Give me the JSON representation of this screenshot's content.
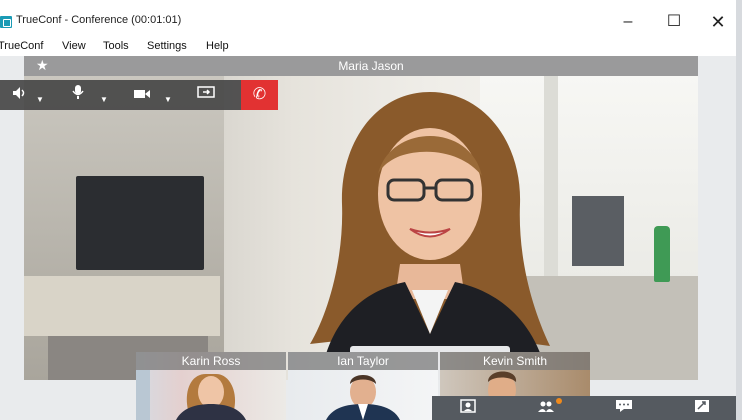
{
  "window": {
    "title": "TrueConf - Conference (00:01:01)",
    "min_label": "–",
    "max_label": "☐",
    "close_label": "✕"
  },
  "menu": [
    "TrueConf",
    "View",
    "Tools",
    "Settings",
    "Help"
  ],
  "conference": {
    "main_speaker": "Maria Jason",
    "star_glyph": "★",
    "hangup_glyph": "✆"
  },
  "participants": [
    {
      "name": "Karin Ross"
    },
    {
      "name": "Ian Taylor"
    },
    {
      "name": "Kevin Smith"
    }
  ],
  "toolbar": {
    "speaker_icon": "speaker-icon",
    "mic_icon": "microphone-icon",
    "camera_icon": "camera-icon",
    "share_icon": "screen-share-icon",
    "hangup_icon": "hangup-icon"
  },
  "bottom_toolbar": {
    "icons": [
      "participant-icon",
      "group-icon",
      "chat-icon",
      "fullscreen-icon"
    ]
  },
  "colors": {
    "hangup_bg": "#e23232",
    "brand": "#1a9bb5",
    "notif": "#f08a1c"
  }
}
